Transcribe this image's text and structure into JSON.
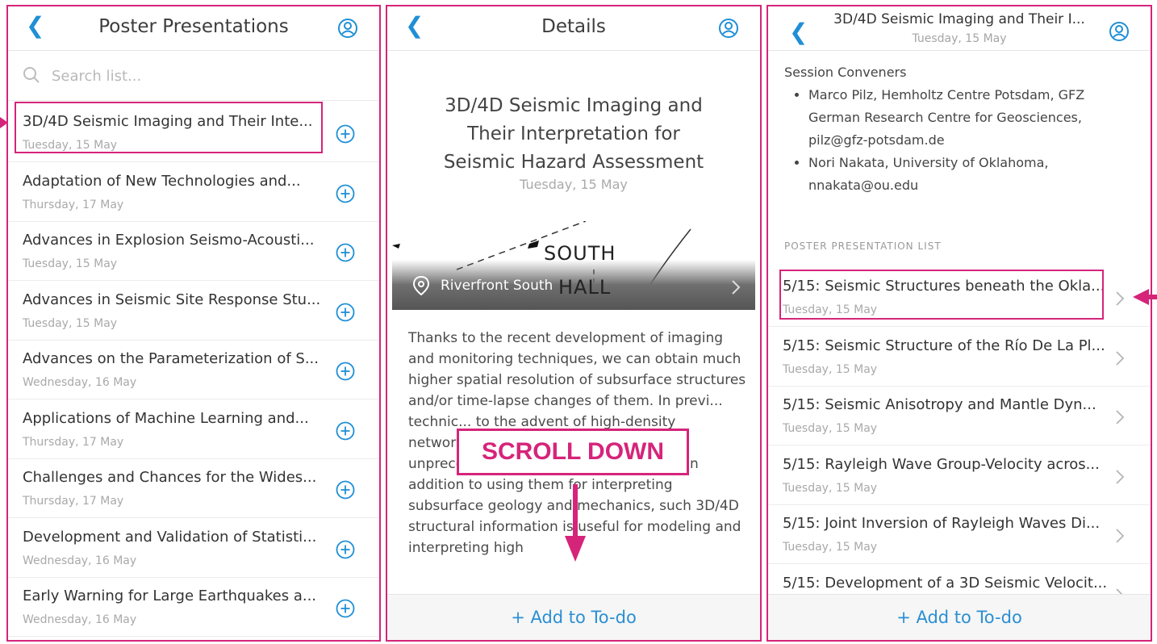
{
  "colors": {
    "accent": "#1f8fd6",
    "highlight": "#d6247a"
  },
  "list_panel": {
    "title": "Poster Presentations",
    "search_placeholder": "Search list...",
    "items": [
      {
        "title": "3D/4D Seismic Imaging and Their Inte...",
        "date": "Tuesday, 15 May"
      },
      {
        "title": "Adaptation of New Technologies and...",
        "date": "Thursday, 17 May"
      },
      {
        "title": "Advances in Explosion Seismo-Acousti...",
        "date": "Tuesday, 15 May"
      },
      {
        "title": "Advances in Seismic Site Response Stu...",
        "date": "Tuesday, 15 May"
      },
      {
        "title": "Advances on the Parameterization of S...",
        "date": "Wednesday, 16 May"
      },
      {
        "title": "Applications of Machine Learning and...",
        "date": "Thursday, 17 May"
      },
      {
        "title": "Challenges and Chances for the Wides...",
        "date": "Thursday, 17 May"
      },
      {
        "title": "Development and Validation of Statisti...",
        "date": "Wednesday, 16 May"
      },
      {
        "title": "Early Warning for Large Earthquakes a...",
        "date": "Wednesday, 16 May"
      }
    ]
  },
  "details_panel": {
    "title": "Details",
    "session_title_lines": [
      "3D/4D Seismic Imaging and",
      "Their Interpretation for",
      "Seismic Hazard Assessment"
    ],
    "date": "Tuesday, 15 May",
    "map": {
      "location": "Riverfront South",
      "label_south": "SOUTH",
      "label_hall": "HALL"
    },
    "description": "Thanks to the recent development of imaging and monitoring techniques, we can obtain much higher spatial resolution of subsurface structures and/or time-lapse changes of them. In previ... technic... to the advent of high-density networks, new modeling techniques and unprecedented computation capacities. In addition to using them for interpreting subsurface geology and mechanics, such 3D/4D structural information is useful for modeling and interpreting high",
    "add_label": "+ Add to To-do",
    "overlay_label": "SCROLL DOWN"
  },
  "session_panel": {
    "title": "3D/4D Seismic Imaging and Their I...",
    "date": "Tuesday, 15 May",
    "conveners_heading": "Session Conveners",
    "conveners": [
      "Marco Pilz, Hemholtz Centre Potsdam, GFZ German Research Centre for Geosciences, pilz@gfz-potsdam.de",
      "Nori Nakata, University of Oklahoma, nnakata@ou.edu"
    ],
    "list_heading": "POSTER PRESENTATION LIST",
    "items": [
      {
        "title": "5/15: Seismic Structures beneath the Okla...",
        "date": "Tuesday, 15 May"
      },
      {
        "title": "5/15: Seismic Structure of the Río De La Pl...",
        "date": "Tuesday, 15 May"
      },
      {
        "title": "5/15: Seismic Anisotropy and Mantle Dyn...",
        "date": "Tuesday, 15 May"
      },
      {
        "title": "5/15: Rayleigh Wave Group-Velocity acros...",
        "date": "Tuesday, 15 May"
      },
      {
        "title": "5/15: Joint Inversion of Rayleigh Waves Di...",
        "date": "Tuesday, 15 May"
      },
      {
        "title": "5/15: Development of a 3D Seismic Velocit...",
        "date": "Tuesday, 15 May"
      }
    ],
    "add_label": "+ Add to To-do"
  }
}
